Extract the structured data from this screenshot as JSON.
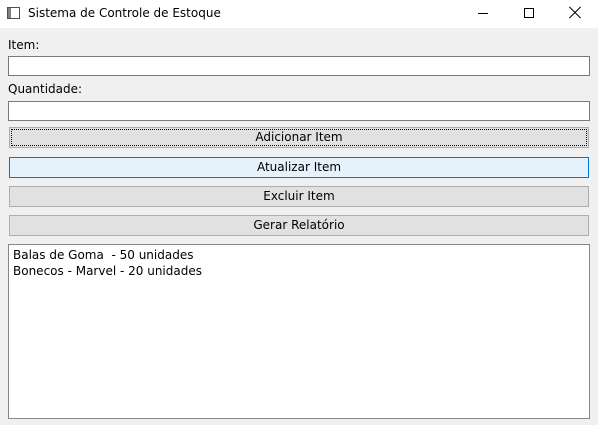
{
  "window": {
    "title": "Sistema de Controle de Estoque",
    "icon": "app-window-icon",
    "controls": [
      "minimize-icon",
      "maximize-icon",
      "close-icon"
    ]
  },
  "form": {
    "item_label": "Item:",
    "item_value": "",
    "quantity_label": "Quantidade:",
    "quantity_value": ""
  },
  "buttons": {
    "add": "Adicionar Item",
    "update": "Atualizar Item",
    "delete": "Excluir Item",
    "report": "Gerar Relatório"
  },
  "list": {
    "items": [
      "Balas de Goma  - 50 unidades",
      "Bonecos - Marvel - 20 unidades"
    ]
  },
  "colors": {
    "window_bg": "#f0f0f0",
    "button_bg": "#e1e1e1",
    "button_hover_bg": "#e5f1fb",
    "accent_border": "#0078d7"
  }
}
